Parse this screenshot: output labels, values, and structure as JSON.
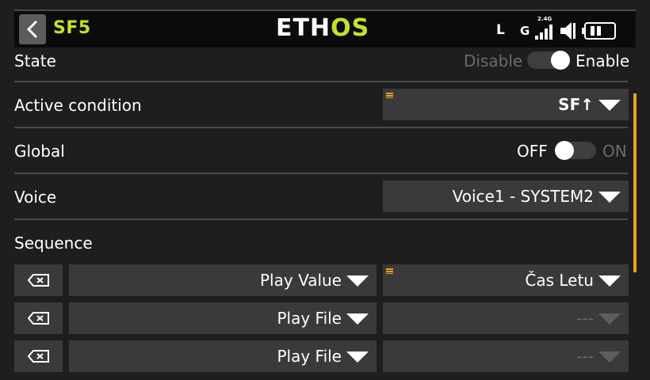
{
  "header": {
    "title": "SF5",
    "logo_part1": "ETH",
    "logo_part2": "OS",
    "status": {
      "trainer": "L",
      "gps": "G",
      "band": "2.4G"
    }
  },
  "rows": {
    "state": {
      "label": "State",
      "off_label": "Disable",
      "on_label": "Enable",
      "value": "Enable"
    },
    "active_condition": {
      "label": "Active condition",
      "value": "SF↑"
    },
    "global": {
      "label": "Global",
      "off_label": "OFF",
      "on_label": "ON",
      "value": "OFF"
    },
    "voice": {
      "label": "Voice",
      "value": "Voice1 - SYSTEM2"
    },
    "sequence": {
      "label": "Sequence"
    }
  },
  "sequence_items": [
    {
      "action": "Play Value",
      "param": "Čas Letu",
      "param_enabled": true
    },
    {
      "action": "Play File",
      "param": "---",
      "param_enabled": false
    },
    {
      "action": "Play File",
      "param": "---",
      "param_enabled": false
    }
  ],
  "colors": {
    "accent": "#c6e02c",
    "highlight": "#e8a21e",
    "field_bg": "#3a3a3a"
  }
}
